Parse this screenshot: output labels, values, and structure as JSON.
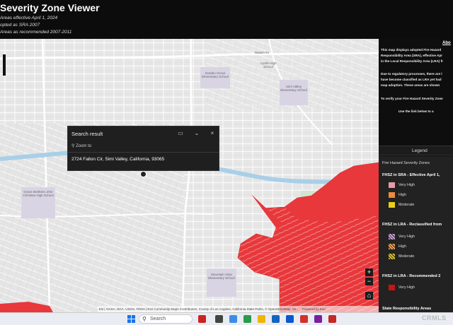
{
  "header": {
    "title": "Severity Zone Viewer",
    "lines": [
      "Areas effective April 1, 2024",
      "opted as SRA 2007",
      "Areas as recommended 2007-2011"
    ]
  },
  "map": {
    "labels": [
      "Station #1",
      "Garden Grove Elementary School",
      "Apollo High School",
      "Simi Valley Elementary School",
      "Grace Brethren Jr/Sr Christian High School",
      "Mountain View Elementary School"
    ],
    "attribution": "Esri, NASA, NGA, USGS, FEMA | Esri Community Maps Contributors, County of Los Angeles, California State Parks, © OpenStreetMap, Mi...",
    "powered_by": "Powered by Esri",
    "zoom_in": "+",
    "zoom_out": "−",
    "home": "⌂",
    "fill_color": "#e8383b"
  },
  "search_popup": {
    "title": "Search result",
    "zoom_to": "Zoom to",
    "address": "2724 Fallon Cir, Simi Valley, California, 93065",
    "dock_icon": "▭",
    "collapse_icon": "⌄",
    "close_icon": "×"
  },
  "panel": {
    "about_title": "Abo",
    "about_lines": [
      "This map displays adopted Fire Hazard",
      "Responsibility Area (SRA), effective Apr",
      "in the Local Responsibility Area (LRA) fr"
    ],
    "reg_lines": [
      "Due to regulatory processes, there are l",
      "have become classified as LRA yet had",
      "map adoption.  These areas are shown"
    ],
    "verify": "To verify your Fire Hazard Severity Zone",
    "use_link": "Use the link below to a",
    "legend_tab": "Legend",
    "legend": {
      "heading": "Fire Hazard Severity Zones",
      "sections": [
        {
          "title": "FHSZ in SRA - Effective April 1,",
          "items": [
            {
              "label": "Very High",
              "color": "#e89aa7"
            },
            {
              "label": "High",
              "color": "#f08a3c"
            },
            {
              "label": "Moderate",
              "color": "#e8d01a"
            }
          ]
        },
        {
          "title": "FHSZ in LRA - Reclassified from",
          "items": [
            {
              "label": "Very High",
              "color": "#c7a0d8"
            },
            {
              "label": "High",
              "color": "#f0a050"
            },
            {
              "label": "Moderate",
              "color": "#d8c030"
            }
          ]
        },
        {
          "title": "FHSZ in LRA - Recommended 2",
          "items": [
            {
              "label": "Very High",
              "color": "#c81414"
            }
          ]
        }
      ],
      "next_section": "State Responsibility Areas"
    }
  },
  "taskbar": {
    "search_placeholder": "Search",
    "watermark": "CRMLS"
  }
}
